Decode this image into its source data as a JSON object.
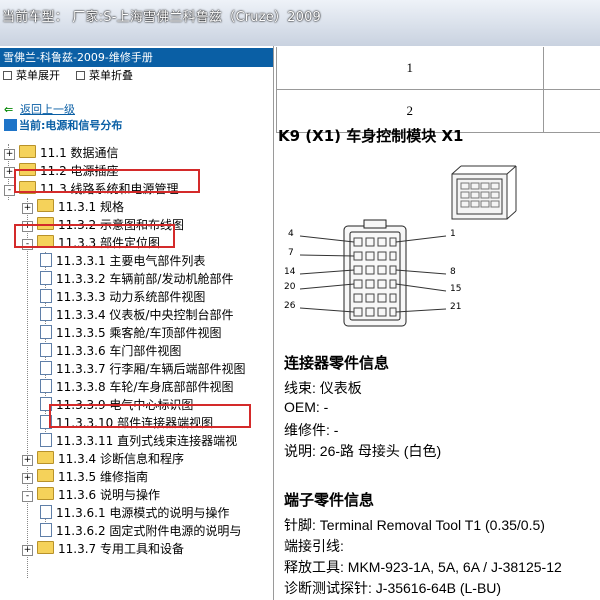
{
  "window": {
    "title": "当前车型：  厂家:S-上海雪佛兰科鲁兹（Cruze）2009"
  },
  "left_panel": {
    "manual_title": "雪佛兰-科鲁兹-2009-维修手册",
    "toolbar": {
      "expand": "菜单展开",
      "collapse": "菜单折叠"
    },
    "back": "返回上一级",
    "current": "当前:电源和信号分布",
    "tree": [
      {
        "label": "11.1 数据通信",
        "state": "+",
        "type": "folder"
      },
      {
        "label": "11.2 电源插座",
        "state": "+",
        "type": "folder"
      },
      {
        "label": "11.3 线路系统和电源管理",
        "state": "-",
        "type": "folder"
      },
      {
        "label": "11.3.1 规格",
        "state": "+",
        "type": "folder"
      },
      {
        "label": "11.3.2 示意图和布线图",
        "state": "+",
        "type": "folder"
      },
      {
        "label": "11.3.3 部件定位图",
        "state": "-",
        "type": "folder"
      },
      {
        "label": "11.3.3.1 主要电气部件列表",
        "type": "page"
      },
      {
        "label": "11.3.3.2 车辆前部/发动机舱部件",
        "type": "page"
      },
      {
        "label": "11.3.3.3 动力系统部件视图",
        "type": "page"
      },
      {
        "label": "11.3.3.4 仪表板/中央控制台部件",
        "type": "page"
      },
      {
        "label": "11.3.3.5 乘客舱/车顶部件视图",
        "type": "page"
      },
      {
        "label": "11.3.3.6 车门部件视图",
        "type": "page"
      },
      {
        "label": "11.3.3.7 行李厢/车辆后端部件视图",
        "type": "page"
      },
      {
        "label": "11.3.3.8 车轮/车身底部部件视图",
        "type": "page"
      },
      {
        "label": "11.3.3.9 电气中心标识图",
        "type": "page"
      },
      {
        "label": "11.3.3.10 部件连接器端视图",
        "type": "page",
        "selected": true
      },
      {
        "label": "11.3.3.11 直列式线束连接器端视",
        "type": "page"
      },
      {
        "label": "11.3.4 诊断信息和程序",
        "state": "+",
        "type": "folder"
      },
      {
        "label": "11.3.5 维修指南",
        "state": "+",
        "type": "folder"
      },
      {
        "label": "11.3.6 说明与操作",
        "state": "-",
        "type": "folder"
      },
      {
        "label": "11.3.6.1 电源模式的说明与操作",
        "type": "page"
      },
      {
        "label": "11.3.6.2 固定式附件电源的说明与",
        "type": "page"
      },
      {
        "label": "11.3.7 专用工具和设备",
        "state": "+",
        "type": "folder"
      }
    ]
  },
  "right_panel": {
    "table_rows": [
      "1",
      "2"
    ],
    "heading": "K9 (X1) 车身控制模块 X1",
    "pin_labels": {
      "left": [
        "4",
        "7",
        "14",
        "20",
        "26"
      ],
      "right": [
        "1",
        "8",
        "15",
        "21"
      ]
    },
    "connector_section": {
      "title": "连接器零件信息",
      "lines": [
        "线束: 仪表板",
        "OEM: -",
        "维修件: -",
        "说明: 26-路 母接头 (白色)"
      ]
    },
    "terminal_section": {
      "title": "端子零件信息",
      "lines": [
        "针脚: Terminal Removal Tool T1 (0.35/0.5)",
        "端接引线:",
        "释放工具: MKM-923-1A, 5A, 6A / J-38125-12",
        "诊断测试探针: J-35616-64B (L-BU)"
      ]
    }
  },
  "colors": {
    "accent": "#0a5fa5",
    "highlight_box": "#d42a2a",
    "folder": "#f5d25a"
  }
}
